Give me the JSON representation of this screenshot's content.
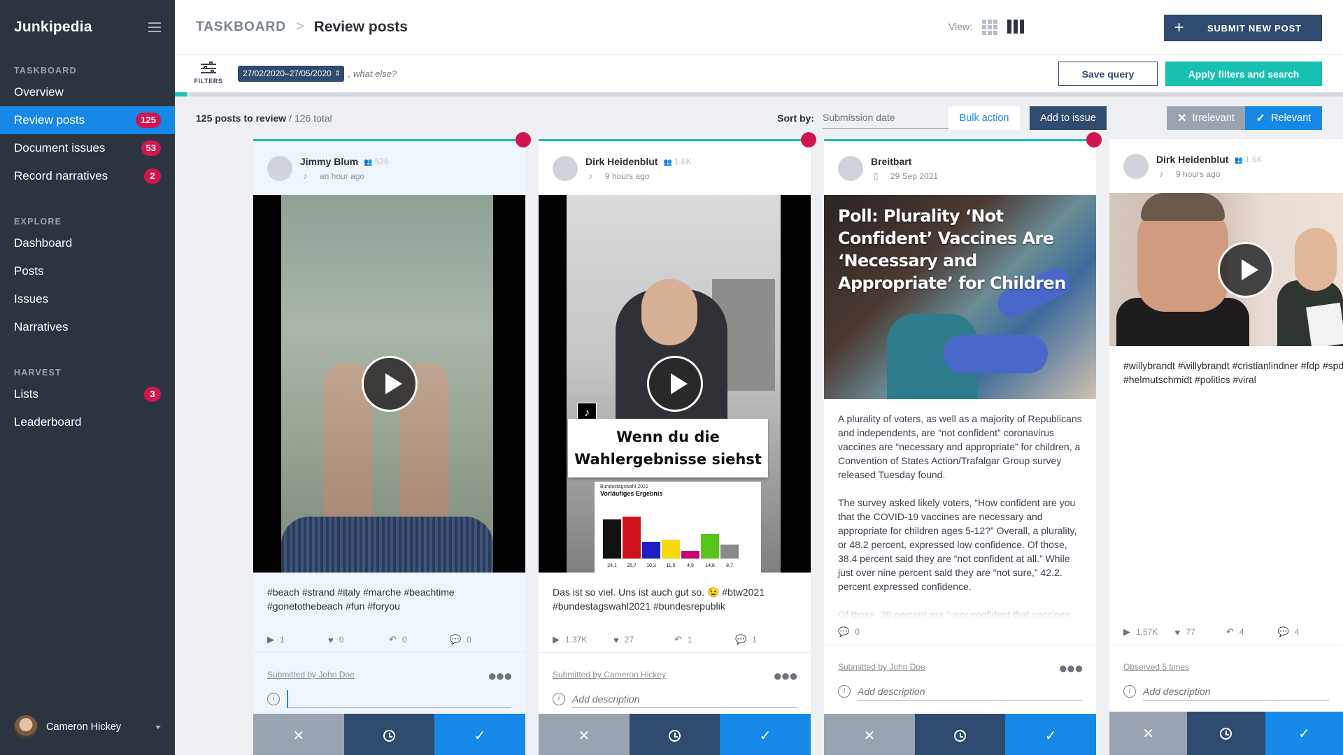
{
  "sidebar": {
    "brand": "Junkipedia",
    "sections": [
      {
        "title": "TASKBOARD",
        "items": [
          {
            "label": "Overview",
            "badge": null,
            "active": false
          },
          {
            "label": "Review posts",
            "badge": "125",
            "active": true
          },
          {
            "label": "Document issues",
            "badge": "53",
            "active": false
          },
          {
            "label": "Record narratives",
            "badge": "2",
            "active": false
          }
        ]
      },
      {
        "title": "EXPLORE",
        "items": [
          {
            "label": "Dashboard"
          },
          {
            "label": "Posts"
          },
          {
            "label": "Issues"
          },
          {
            "label": "Narratives"
          }
        ]
      },
      {
        "title": "HARVEST",
        "items": [
          {
            "label": "Lists",
            "badge": "3"
          },
          {
            "label": "Leaderboard"
          }
        ]
      }
    ],
    "user": {
      "name": "Cameron Hickey"
    }
  },
  "header": {
    "breadcrumb_root": "TASKBOARD",
    "breadcrumb_sep": ">",
    "title": "Review posts",
    "view_label": "View:",
    "submit_label": "SUBMIT NEW POST",
    "submit_icon": "+"
  },
  "filters": {
    "label": "FILTERS",
    "date_range": "27/02/2020–27/05/2020",
    "search_placeholder": ", what else?",
    "save_query": "Save query",
    "apply": "Apply filters and search",
    "progress_fraction": 0.01
  },
  "toolbar": {
    "count_main": "125 posts to review",
    "count_total": "/ 126 total",
    "sort_label": "Sort by:",
    "sort_value": "Submission date",
    "sort_direction_icon": "←",
    "bulk_action": "Bulk action",
    "add_to_issue": "Add to issue",
    "irrelevant": "Irrelevant",
    "irrelevant_icon": "✕",
    "relevant": "Relevant",
    "relevant_icon": "✓"
  },
  "posts": [
    {
      "author": "Jimmy Blum",
      "followers": "526",
      "platform_icon": "♪",
      "time": "an hour ago",
      "text": "#beach #strand #italy #marche #beachtime #gonetothebeach #fun #foryou",
      "stats": {
        "plays": "1",
        "likes": "0",
        "shares": "0",
        "comments": "0"
      },
      "submitted_by": "Submitted by John Doe",
      "description_placeholder": "",
      "selected": true
    },
    {
      "author": "Dirk Heidenblut",
      "followers": "1.6K",
      "platform_icon": "♪",
      "time": "9 hours ago",
      "text": "Das ist so viel. Uns ist auch gut so. 😉 #btw2021 #bundestagswahl2021 #bundesrepublik",
      "media_caption": "Wenn du die Wahlergebnisse siehst",
      "chart_title_small": "Bundestagswahl 2021",
      "chart_subtitle_small": "Vorläufiges Ergebnis",
      "bar_values": [
        "24,1",
        "25,7",
        "10,3",
        "11,5",
        "4,9",
        "14,8",
        "8,7"
      ],
      "stats": {
        "plays": "1.37K",
        "likes": "27",
        "shares": "1",
        "comments": "1"
      },
      "submitted_by": "Submitted by Cameron Hickey",
      "description_placeholder": "Add description",
      "selected": true
    },
    {
      "author": "Breitbart",
      "platform_icon": "▯",
      "time": "29 Sep 2021",
      "headline": "Poll: Plurality ‘Not Confident’ Vaccines Are ‘Necessary and Appropriate’ for Children",
      "paragraphs": [
        "A plurality of voters, as well as a majority of Republicans and independents, are “not confident” coronavirus vaccines are “necessary and appropriate” for children, a Convention of States Action/Trafalgar Group survey released Tuesday found.",
        "The survey asked likely voters, “How confident are you that the COVID-19 vaccines are necessary and appropriate for children ages 5-12?” Overall, a plurality, or 48.2 percent, expressed low confidence. Of those, 38.4 percent said they are “not confident at all.” While just over nine percent said they are “not sure,” 42.2. percent expressed confidence.",
        "Of those, 28 percent are “very confident that vaccines"
      ],
      "stats": {
        "comments": "0"
      },
      "submitted_by": "Submitted by John Doe",
      "description_placeholder": "Add description",
      "selected": true
    },
    {
      "author": "Dirk Heidenblut",
      "followers": "1.6K",
      "platform_icon": "♪",
      "time": "9 hours ago",
      "text": "#willybrandt #willybrandt #cristianlindner #fdp #spd #helmutschmidt #politics #viral",
      "stats": {
        "plays": "1.57K",
        "likes": "77",
        "shares": "4",
        "comments": "4"
      },
      "submitted_by": "Observed 5 times",
      "description_placeholder": "Add description",
      "selected": false
    }
  ],
  "colors": {
    "sidebar_bg": "#2c3440",
    "active_nav": "#1689e8",
    "badge": "#d3154f",
    "navy": "#2f4b6f",
    "teal": "#17c0b0",
    "irrelevant_gray": "#9aa4b0"
  },
  "bar_colors": [
    "#111111",
    "#d0121b",
    "#1b1fc4",
    "#f5d90a",
    "#c8007a",
    "#56c71a",
    "#8a8a8a"
  ]
}
